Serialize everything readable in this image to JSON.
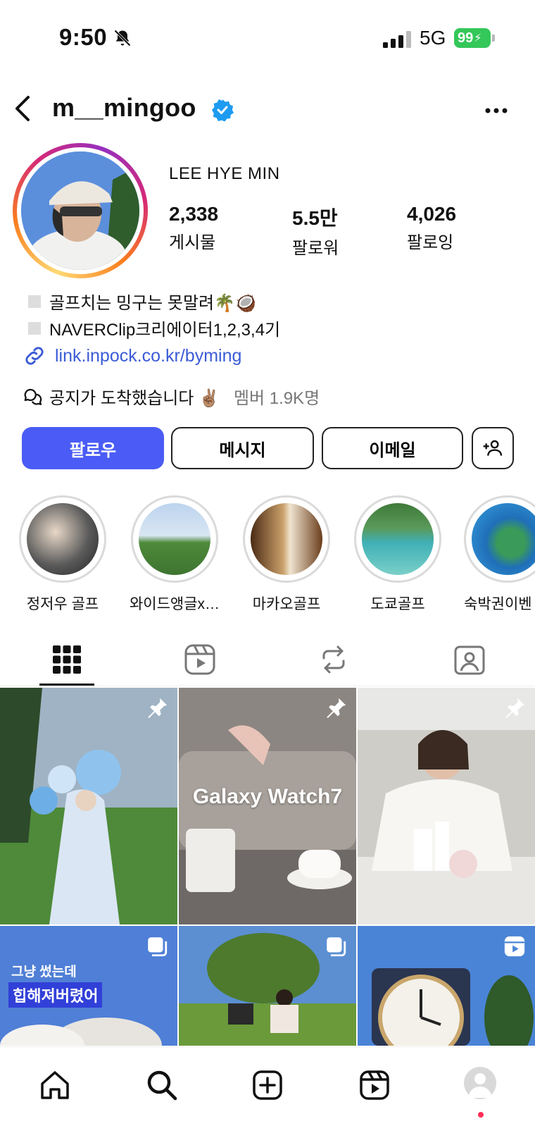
{
  "status_bar": {
    "time": "9:50",
    "network": "5G",
    "battery": "99"
  },
  "header": {
    "username": "m__mingoo",
    "verified": true
  },
  "profile": {
    "display_name": "LEE HYE MIN",
    "stats": [
      {
        "value": "2,338",
        "label": "게시물"
      },
      {
        "value": "5.5만",
        "label": "팔로워"
      },
      {
        "value": "4,026",
        "label": "팔로잉"
      }
    ],
    "bio": [
      "골프치는 밍구는 못말려🌴🥥",
      "NAVERClip크리에이터1,2,3,4기"
    ],
    "link": "link.inpock.co.kr/byming",
    "notice": {
      "text": "공지가 도착했습니다 ✌🏽",
      "sub": "멤버 1.9K명"
    }
  },
  "buttons": {
    "follow": "팔로우",
    "message": "메시지",
    "email": "이메일"
  },
  "highlights": [
    {
      "label": "정저우 골프"
    },
    {
      "label": "와이드앵글x…"
    },
    {
      "label": "마카오골프"
    },
    {
      "label": "도쿄골프"
    },
    {
      "label": "숙박권이벤"
    }
  ],
  "grid": {
    "tile_texts": {
      "galaxy": "Galaxy Watch7",
      "caption_line1": "그냥 썼는데",
      "caption_line2": "힙해져버렸어"
    }
  },
  "colors": {
    "primary_button": "#4a5cf5",
    "link": "#3b5bd6",
    "verified": "#1d9bf0",
    "battery": "#34c759",
    "notification_dot": "#ff2d55"
  },
  "icons": {
    "header": [
      "back-icon",
      "verified-icon",
      "more-icon"
    ],
    "tabs": [
      "grid-icon",
      "reels-icon",
      "reposts-icon",
      "tagged-icon"
    ],
    "bottom_nav": [
      "home-icon",
      "search-icon",
      "create-icon",
      "reels-icon",
      "profile-avatar"
    ]
  }
}
